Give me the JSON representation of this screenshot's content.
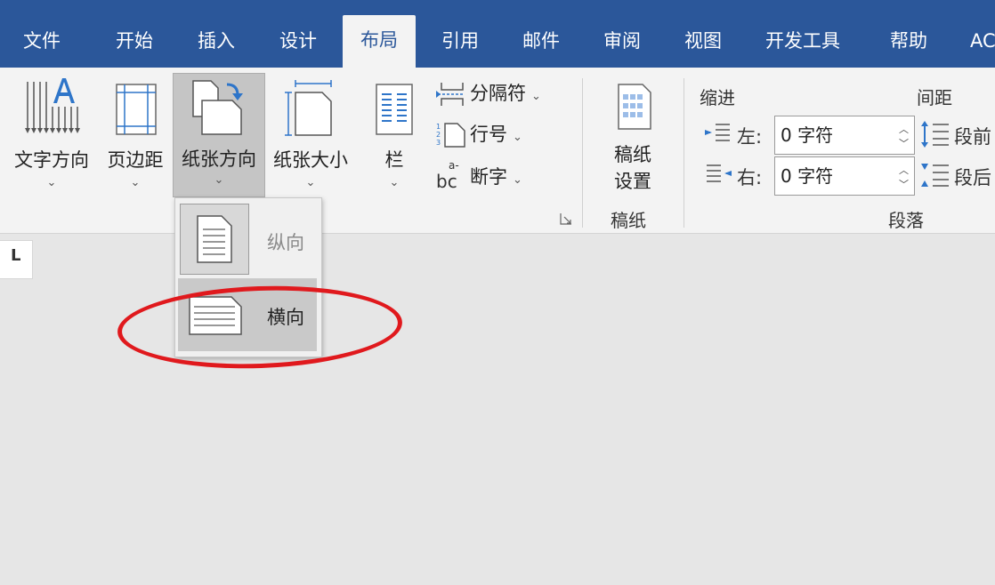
{
  "tabs": [
    {
      "label": "文件",
      "active": false
    },
    {
      "label": "开始",
      "active": false
    },
    {
      "label": "插入",
      "active": false
    },
    {
      "label": "设计",
      "active": false
    },
    {
      "label": "布局",
      "active": true
    },
    {
      "label": "引用",
      "active": false
    },
    {
      "label": "邮件",
      "active": false
    },
    {
      "label": "审阅",
      "active": false
    },
    {
      "label": "视图",
      "active": false
    },
    {
      "label": "开发工具",
      "active": false
    },
    {
      "label": "帮助",
      "active": false
    },
    {
      "label": "AC",
      "active": false
    }
  ],
  "page_setup": {
    "text_direction": "文字方向",
    "margins": "页边距",
    "orientation": "纸张方向",
    "size": "纸张大小",
    "columns": "栏",
    "breaks": "分隔符",
    "line_numbers": "行号",
    "hyphenation": "断字",
    "hyphen_icon_text": "bc",
    "hyphen_icon_sup": "a-"
  },
  "manuscript": {
    "button_line1": "稿纸",
    "button_line2": "设置",
    "group_label": "稿纸"
  },
  "paragraph": {
    "indent_header": "缩进",
    "spacing_header": "间距",
    "left_label": "左:",
    "left_value": "0 字符",
    "right_label": "右:",
    "right_value": "0 字符",
    "before_label": "段前",
    "after_label": "段后",
    "group_label": "段落"
  },
  "orientation_menu": {
    "portrait": "纵向",
    "landscape": "横向"
  },
  "ruler_marker": "L",
  "colors": {
    "tab_bar": "#2b579a",
    "ribbon": "#f3f3f3",
    "document": "#e6e6e6",
    "highlight": "#e0191d",
    "icon_blue": "#2e75c9"
  }
}
